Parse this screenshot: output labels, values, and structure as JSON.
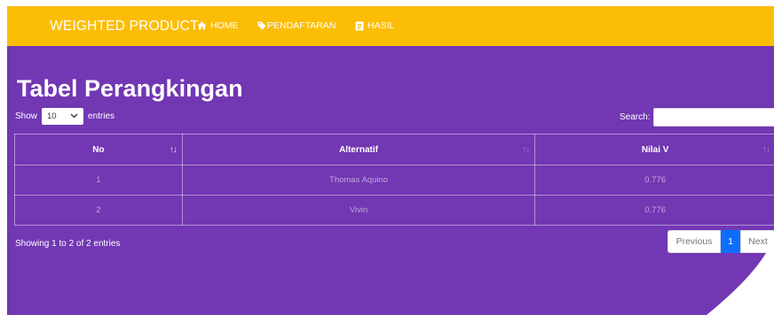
{
  "navbar": {
    "brand": "WEIGHTED PRODUCT",
    "items": [
      {
        "label": "HOME",
        "icon": "home-icon"
      },
      {
        "label": "PENDAFTARAN",
        "icon": "tag-icon"
      },
      {
        "label": "HASIL",
        "icon": "document-icon"
      }
    ]
  },
  "page": {
    "title": "Tabel Perangkingan"
  },
  "length": {
    "prefix": "Show",
    "value": "10",
    "suffix": "entries"
  },
  "search": {
    "label": "Search:",
    "value": ""
  },
  "table": {
    "headers": [
      "No",
      "Alternatif",
      "Nilai V"
    ],
    "rows": [
      [
        "1",
        "Thomas Aquino",
        "0.776"
      ],
      [
        "2",
        "Vivin",
        "0.776"
      ]
    ]
  },
  "info": "Showing 1 to 2 of 2 entries",
  "pagination": {
    "previous": "Previous",
    "current": "1",
    "next": "Next"
  },
  "colors": {
    "navbar": "#fcbd06",
    "background": "#7237b3",
    "active_page": "#0d6efd"
  }
}
